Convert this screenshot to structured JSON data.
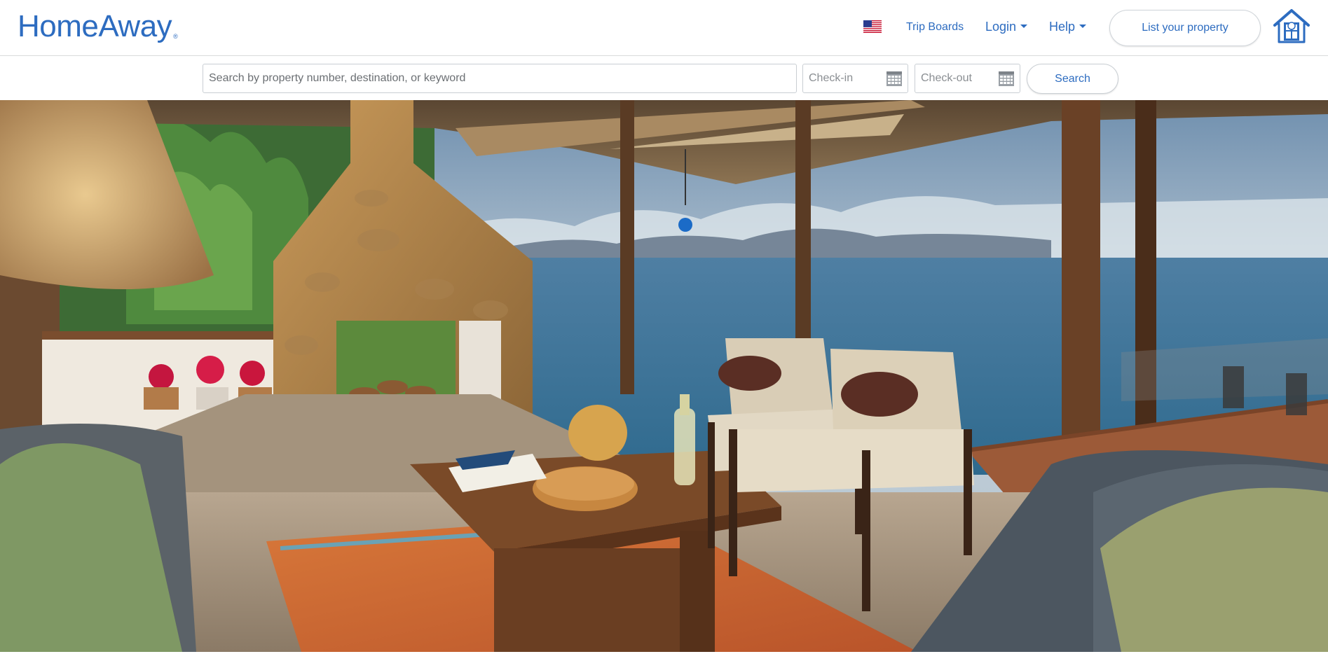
{
  "brand": {
    "name": "HomeAway",
    "reg_mark": "®",
    "color": "#2d6cc0"
  },
  "header": {
    "flag_icon": "us-flag-icon",
    "nav": {
      "trip_boards": "Trip Boards",
      "login": "Login",
      "help": "Help"
    },
    "list_property_label": "List your property",
    "house_icon": "homeaway-house-icon"
  },
  "search": {
    "placeholder": "Search by property number, destination, or keyword",
    "value": "",
    "checkin_placeholder": "Check-in",
    "checkout_placeholder": "Check-out",
    "calendar_icon": "calendar-icon",
    "button_label": "Search"
  },
  "hero": {
    "image_subject": "open-air living room with stone fireplace overlooking the ocean"
  }
}
